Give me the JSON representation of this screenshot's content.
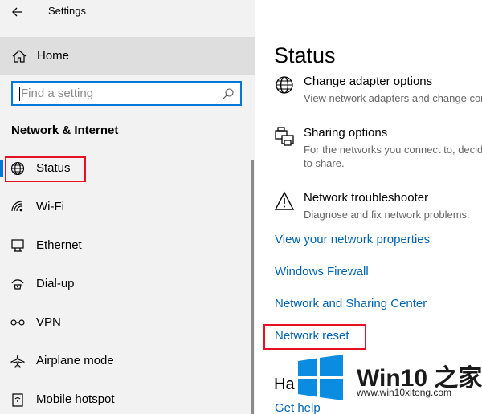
{
  "window": {
    "title": "Settings"
  },
  "sidebar": {
    "home_label": "Home",
    "search_placeholder": "Find a setting",
    "section_title": "Network & Internet",
    "items": [
      {
        "label": "Status",
        "icon": "globe-icon",
        "selected": true
      },
      {
        "label": "Wi-Fi",
        "icon": "wifi-icon"
      },
      {
        "label": "Ethernet",
        "icon": "ethernet-icon"
      },
      {
        "label": "Dial-up",
        "icon": "dialup-icon"
      },
      {
        "label": "VPN",
        "icon": "vpn-icon"
      },
      {
        "label": "Airplane mode",
        "icon": "airplane-icon"
      },
      {
        "label": "Mobile hotspot",
        "icon": "hotspot-icon"
      }
    ]
  },
  "main": {
    "title": "Status",
    "options": [
      {
        "title": "Change adapter options",
        "desc": "View network adapters and change con",
        "icon": "globe-icon"
      },
      {
        "title": "Sharing options",
        "desc": "For the networks you connect to, decid",
        "desc2": "to share.",
        "icon": "printer-icon"
      },
      {
        "title": "Network troubleshooter",
        "desc": "Diagnose and fix network problems.",
        "icon": "warning-icon"
      }
    ],
    "links": [
      "View your network properties",
      "Windows Firewall",
      "Network and Sharing Center",
      "Network reset"
    ],
    "partial_heading": "Ha",
    "partial_link": "Get help"
  },
  "watermark": {
    "brand": "Win10 之家",
    "site": "www.win10xitong.com"
  },
  "colors": {
    "accent": "#0078d7",
    "link": "#0063b1",
    "highlight": "#e81123"
  }
}
